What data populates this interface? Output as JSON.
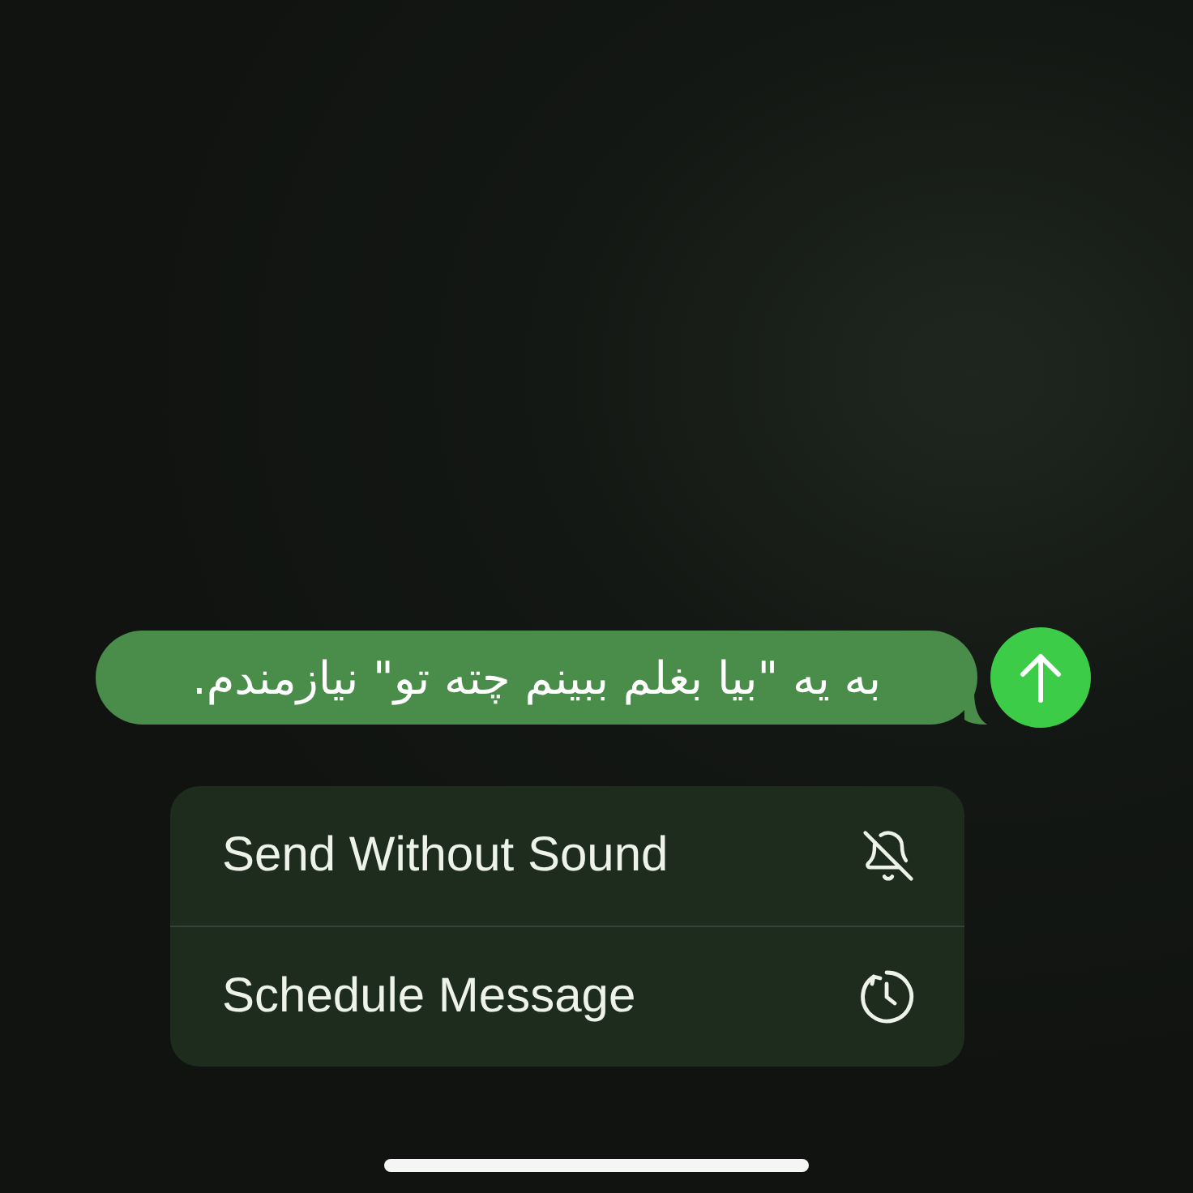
{
  "message": {
    "text": "به یه \"بیا بغلم ببینم چته تو\" نیازمندم."
  },
  "menu": [
    {
      "label": "Send Without Sound",
      "kind": "bell-off"
    },
    {
      "label": "Schedule Message",
      "kind": "schedule"
    }
  ]
}
